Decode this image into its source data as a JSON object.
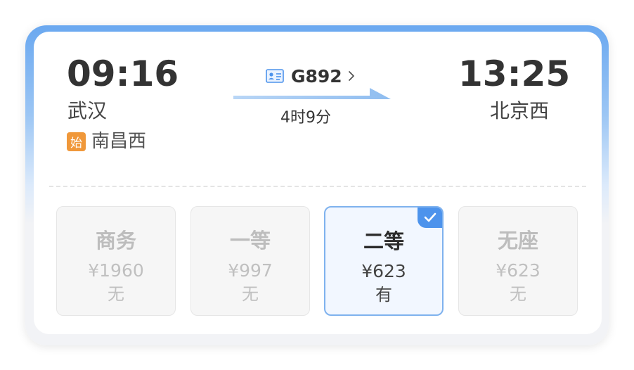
{
  "trip": {
    "departure_time": "09:16",
    "departure_station": "武汉",
    "origin_badge": "始",
    "origin_station": "南昌西",
    "train_number": "G892",
    "duration": "4时9分",
    "arrival_time": "13:25",
    "arrival_station": "北京西"
  },
  "seats": [
    {
      "name": "商务",
      "price": "¥1960",
      "availability": "无",
      "selected": false
    },
    {
      "name": "一等",
      "price": "¥997",
      "availability": "无",
      "selected": false
    },
    {
      "name": "二等",
      "price": "¥623",
      "availability": "有",
      "selected": true
    },
    {
      "name": "无座",
      "price": "¥623",
      "availability": "无",
      "selected": false
    }
  ],
  "icons": {
    "ticket": "ticket-icon",
    "chevron": "chevron-right-icon",
    "check": "checkmark-icon"
  },
  "colors": {
    "accent": "#4d93ec",
    "origin_badge": "#f0983a",
    "header_gradient": "#6aa8f0"
  }
}
